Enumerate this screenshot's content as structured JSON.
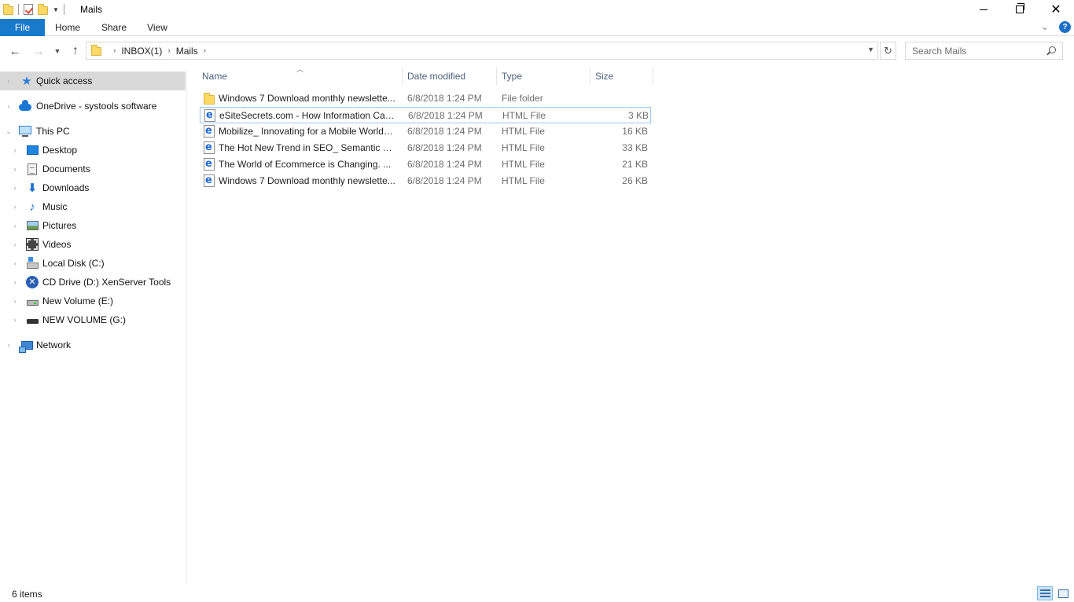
{
  "window": {
    "title": "Mails"
  },
  "ribbon": {
    "tabs": [
      "File",
      "Home",
      "Share",
      "View"
    ]
  },
  "address": {
    "breadcrumb": [
      "INBOX(1)",
      "Mails"
    ],
    "search_placeholder": "Search Mails"
  },
  "nav": {
    "items": [
      {
        "label": "Quick access",
        "icon": "star-icon"
      },
      {
        "label": "OneDrive - systools software",
        "icon": "cloud-icon"
      },
      {
        "label": "This PC",
        "icon": "computer-icon"
      },
      {
        "label": "Desktop",
        "icon": "desktop-icon"
      },
      {
        "label": "Documents",
        "icon": "documents-icon"
      },
      {
        "label": "Downloads",
        "icon": "download-arrow-icon"
      },
      {
        "label": "Music",
        "icon": "music-note-icon"
      },
      {
        "label": "Pictures",
        "icon": "pictures-icon"
      },
      {
        "label": "Videos",
        "icon": "film-icon"
      },
      {
        "label": "Local Disk (C:)",
        "icon": "hard-drive-icon"
      },
      {
        "label": "CD Drive (D:) XenServer Tools",
        "icon": "xenserver-disc-icon"
      },
      {
        "label": "New Volume (E:)",
        "icon": "volume-drive-icon"
      },
      {
        "label": "NEW VOLUME (G:)",
        "icon": "usb-drive-icon"
      },
      {
        "label": "Network",
        "icon": "network-icon"
      }
    ]
  },
  "columns": {
    "name": "Name",
    "date": "Date modified",
    "type": "Type",
    "size": "Size"
  },
  "files": [
    {
      "name": "Windows 7 Download monthly newslette...",
      "date": "6/8/2018 1:24 PM",
      "type": "File folder",
      "size": ""
    },
    {
      "name": "eSiteSecrets.com - How Information Can...",
      "date": "6/8/2018 1:24 PM",
      "type": "HTML File",
      "size": "3 KB"
    },
    {
      "name": "Mobilize_ Innovating for a Mobile World_...",
      "date": "6/8/2018 1:24 PM",
      "type": "HTML File",
      "size": "16 KB"
    },
    {
      "name": "The Hot New Trend in SEO_ Semantic Se...",
      "date": "6/8/2018 1:24 PM",
      "type": "HTML File",
      "size": "33 KB"
    },
    {
      "name": "The World of Ecommerce is Changing. ...",
      "date": "6/8/2018 1:24 PM",
      "type": "HTML File",
      "size": "21 KB"
    },
    {
      "name": "Windows 7 Download monthly newslette...",
      "date": "6/8/2018 1:24 PM",
      "type": "HTML File",
      "size": "26 KB"
    }
  ],
  "status": {
    "item_count": "6 items"
  },
  "colors": {
    "file_tab": "#1979ca",
    "selected_nav": "#d9d9d9",
    "focus_border": "#99c9ef",
    "column_header": "#4c607a"
  }
}
